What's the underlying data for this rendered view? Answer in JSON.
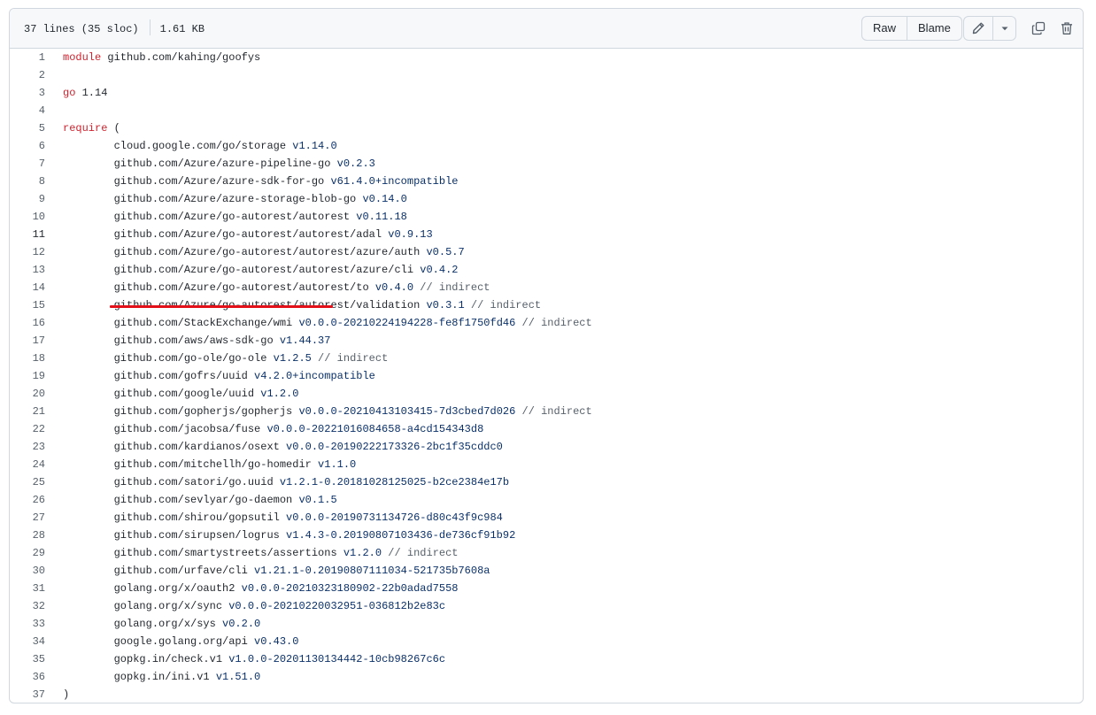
{
  "file_info": {
    "lines": "37 lines (35 sloc)",
    "size": "1.61 KB"
  },
  "toolbar": {
    "raw_label": "Raw",
    "blame_label": "Blame"
  },
  "icons": {
    "edit": "pencil-icon",
    "more": "triangle-down-icon",
    "copy": "copy-icon",
    "delete": "trash-icon"
  },
  "colors": {
    "keyword": "#cf222e",
    "version": "#0a3069",
    "comment": "#57606a",
    "annotation": "#e3101a"
  },
  "annotation": {
    "highlighted_line": 17
  },
  "code_lines": [
    [
      {
        "t": "module",
        "c": "kw"
      },
      {
        "t": " github.com/kahing/goofys"
      }
    ],
    [],
    [
      {
        "t": "go",
        "c": "kw"
      },
      {
        "t": " 1.14"
      }
    ],
    [],
    [
      {
        "t": "require",
        "c": "kw"
      },
      {
        "t": " ("
      }
    ],
    [
      {
        "t": "\tcloud.google.com/go/storage "
      },
      {
        "t": "v1.14.0",
        "c": "ver"
      }
    ],
    [
      {
        "t": "\tgithub.com/Azure/azure-pipeline-go "
      },
      {
        "t": "v0.2.3",
        "c": "ver"
      }
    ],
    [
      {
        "t": "\tgithub.com/Azure/azure-sdk-for-go "
      },
      {
        "t": "v61.4.0+incompatible",
        "c": "ver"
      }
    ],
    [
      {
        "t": "\tgithub.com/Azure/azure-storage-blob-go "
      },
      {
        "t": "v0.14.0",
        "c": "ver"
      }
    ],
    [
      {
        "t": "\tgithub.com/Azure/go-autorest/autorest "
      },
      {
        "t": "v0.11.18",
        "c": "ver"
      }
    ],
    [
      {
        "t": "\tgithub.com/Azure/go-autorest/autorest/adal "
      },
      {
        "t": "v0.9.13",
        "c": "ver"
      }
    ],
    [
      {
        "t": "\tgithub.com/Azure/go-autorest/autorest/azure/auth "
      },
      {
        "t": "v0.5.7",
        "c": "ver"
      }
    ],
    [
      {
        "t": "\tgithub.com/Azure/go-autorest/autorest/azure/cli "
      },
      {
        "t": "v0.4.2",
        "c": "ver"
      }
    ],
    [
      {
        "t": "\tgithub.com/Azure/go-autorest/autorest/to "
      },
      {
        "t": "v0.4.0",
        "c": "ver"
      },
      {
        "t": " // indirect",
        "c": "cm"
      }
    ],
    [
      {
        "t": "\tgithub.com/Azure/go-autorest/autorest/validation "
      },
      {
        "t": "v0.3.1",
        "c": "ver"
      },
      {
        "t": " // indirect",
        "c": "cm"
      }
    ],
    [
      {
        "t": "\tgithub.com/StackExchange/wmi "
      },
      {
        "t": "v0.0.0-20210224194228-fe8f1750fd46",
        "c": "ver"
      },
      {
        "t": " // indirect",
        "c": "cm"
      }
    ],
    [
      {
        "t": "\tgithub.com/aws/aws-sdk-go "
      },
      {
        "t": "v1.44.37",
        "c": "ver"
      }
    ],
    [
      {
        "t": "\tgithub.com/go-ole/go-ole "
      },
      {
        "t": "v1.2.5",
        "c": "ver"
      },
      {
        "t": " // indirect",
        "c": "cm"
      }
    ],
    [
      {
        "t": "\tgithub.com/gofrs/uuid "
      },
      {
        "t": "v4.2.0+incompatible",
        "c": "ver"
      }
    ],
    [
      {
        "t": "\tgithub.com/google/uuid "
      },
      {
        "t": "v1.2.0",
        "c": "ver"
      }
    ],
    [
      {
        "t": "\tgithub.com/gopherjs/gopherjs "
      },
      {
        "t": "v0.0.0-20210413103415-7d3cbed7d026",
        "c": "ver"
      },
      {
        "t": " // indirect",
        "c": "cm"
      }
    ],
    [
      {
        "t": "\tgithub.com/jacobsa/fuse "
      },
      {
        "t": "v0.0.0-20221016084658-a4cd154343d8",
        "c": "ver"
      }
    ],
    [
      {
        "t": "\tgithub.com/kardianos/osext "
      },
      {
        "t": "v0.0.0-20190222173326-2bc1f35cddc0",
        "c": "ver"
      }
    ],
    [
      {
        "t": "\tgithub.com/mitchellh/go-homedir "
      },
      {
        "t": "v1.1.0",
        "c": "ver"
      }
    ],
    [
      {
        "t": "\tgithub.com/satori/go.uuid "
      },
      {
        "t": "v1.2.1-0.20181028125025-b2ce2384e17b",
        "c": "ver"
      }
    ],
    [
      {
        "t": "\tgithub.com/sevlyar/go-daemon "
      },
      {
        "t": "v0.1.5",
        "c": "ver"
      }
    ],
    [
      {
        "t": "\tgithub.com/shirou/gopsutil "
      },
      {
        "t": "v0.0.0-20190731134726-d80c43f9c984",
        "c": "ver"
      }
    ],
    [
      {
        "t": "\tgithub.com/sirupsen/logrus "
      },
      {
        "t": "v1.4.3-0.20190807103436-de736cf91b92",
        "c": "ver"
      }
    ],
    [
      {
        "t": "\tgithub.com/smartystreets/assertions "
      },
      {
        "t": "v1.2.0",
        "c": "ver"
      },
      {
        "t": " // indirect",
        "c": "cm"
      }
    ],
    [
      {
        "t": "\tgithub.com/urfave/cli "
      },
      {
        "t": "v1.21.1-0.20190807111034-521735b7608a",
        "c": "ver"
      }
    ],
    [
      {
        "t": "\tgolang.org/x/oauth2 "
      },
      {
        "t": "v0.0.0-20210323180902-22b0adad7558",
        "c": "ver"
      }
    ],
    [
      {
        "t": "\tgolang.org/x/sync "
      },
      {
        "t": "v0.0.0-20210220032951-036812b2e83c",
        "c": "ver"
      }
    ],
    [
      {
        "t": "\tgolang.org/x/sys "
      },
      {
        "t": "v0.2.0",
        "c": "ver"
      }
    ],
    [
      {
        "t": "\tgoogle.golang.org/api "
      },
      {
        "t": "v0.43.0",
        "c": "ver"
      }
    ],
    [
      {
        "t": "\tgopkg.in/check.v1 "
      },
      {
        "t": "v1.0.0-20201130134442-10cb98267c6c",
        "c": "ver"
      }
    ],
    [
      {
        "t": "\tgopkg.in/ini.v1 "
      },
      {
        "t": "v1.51.0",
        "c": "ver"
      }
    ],
    [
      {
        "t": ")"
      }
    ]
  ],
  "active_line": 11
}
